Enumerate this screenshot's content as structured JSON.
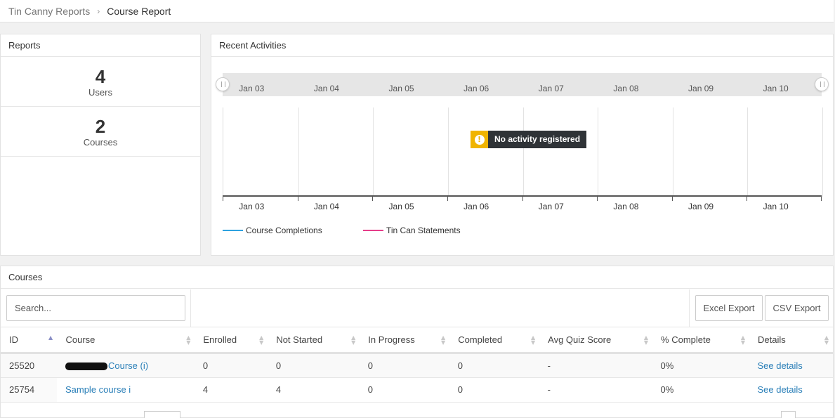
{
  "breadcrumb": {
    "parent": "Tin Canny Reports",
    "separator": "›",
    "current": "Course Report"
  },
  "reports": {
    "title": "Reports",
    "stats": [
      {
        "value": "4",
        "label": "Users"
      },
      {
        "value": "2",
        "label": "Courses"
      }
    ]
  },
  "activities": {
    "title": "Recent Activities",
    "dates": [
      "Jan 03",
      "Jan 04",
      "Jan 05",
      "Jan 06",
      "Jan 07",
      "Jan 08",
      "Jan 09",
      "Jan 10"
    ],
    "no_activity_icon": "!",
    "no_activity_text": "No activity registered",
    "legend": [
      {
        "label": "Course Completions",
        "color": "#2ea2e0"
      },
      {
        "label": "Tin Can Statements",
        "color": "#e63e8a"
      }
    ],
    "warning_color": "#f0b400"
  },
  "courses": {
    "title": "Courses",
    "search_placeholder": "Search...",
    "excel_export": "Excel Export",
    "csv_export": "CSV Export",
    "columns": [
      "ID",
      "Course",
      "Enrolled",
      "Not Started",
      "In Progress",
      "Completed",
      "Avg Quiz Score",
      "% Complete",
      "Details"
    ],
    "rows": [
      {
        "id": "25520",
        "course": "Course (i)",
        "course_redacted": true,
        "enrolled": "0",
        "not_started": "0",
        "in_progress": "0",
        "completed": "0",
        "avg_quiz": "-",
        "pct_complete": "0%",
        "details": "See details"
      },
      {
        "id": "25754",
        "course": "Sample course i",
        "course_redacted": false,
        "enrolled": "4",
        "not_started": "4",
        "in_progress": "0",
        "completed": "0",
        "avg_quiz": "-",
        "pct_complete": "0%",
        "details": "See details"
      }
    ],
    "link_color": "#2a7fb8"
  }
}
